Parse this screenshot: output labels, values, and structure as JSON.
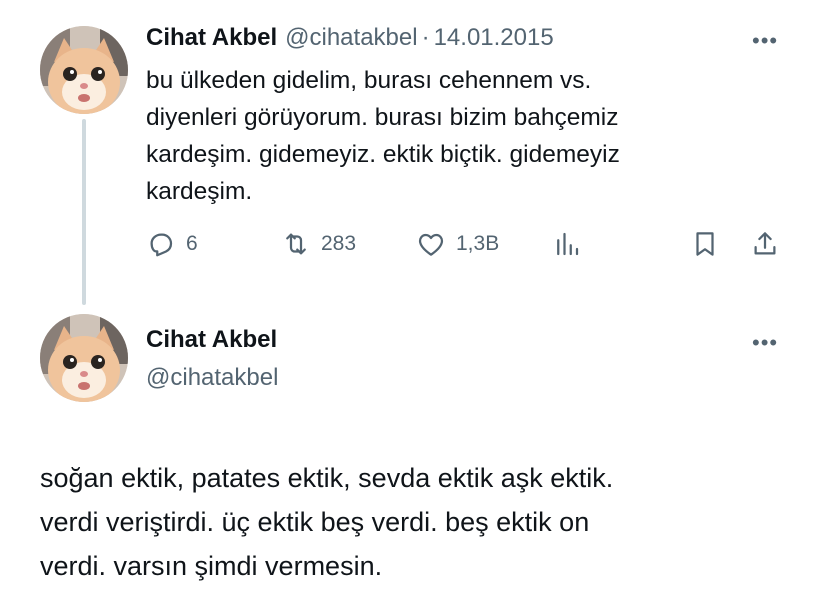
{
  "tweet1": {
    "author_name": "Cihat Akbel",
    "handle": "@cihatakbel",
    "separator": "·",
    "date": "14.01.2015",
    "more": "•••",
    "text": "bu ülkeden gidelim, burası cehennem vs.\ndiyenleri görüyorum. burası bizim bahçemiz\nkardeşim. gidemeyiz. ektik biçtik. gidemeyiz\nkardeşim.",
    "actions": {
      "replies": "6",
      "retweets": "283",
      "likes": "1,3B"
    },
    "icons": [
      "reply-icon",
      "retweet-icon",
      "like-icon",
      "views-icon",
      "bookmark-icon",
      "share-icon"
    ]
  },
  "tweet2": {
    "author_name": "Cihat Akbel",
    "handle": "@cihatakbel",
    "more": "•••",
    "text": "soğan ektik, patates ektik, sevda ektik aşk ektik.\nverdi veriştirdi. üç ektik beş verdi. beş ektik on\nverdi. varsın şimdi vermesin."
  },
  "colors": {
    "text": "#0f1419",
    "secondary": "#536471",
    "thread_line": "#cfd9de"
  }
}
